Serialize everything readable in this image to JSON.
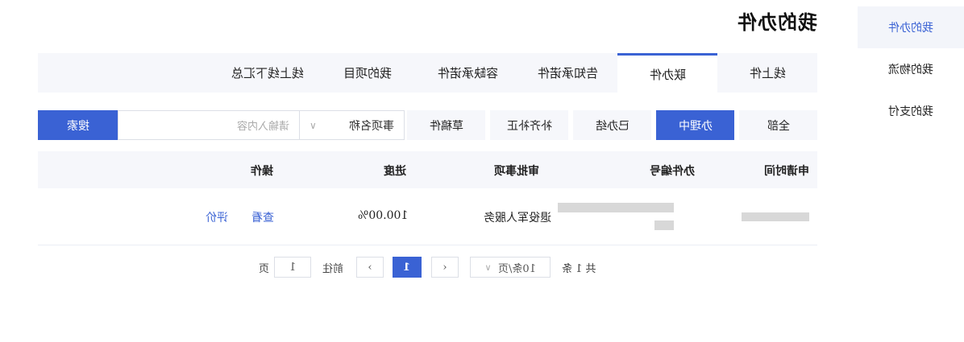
{
  "page_title": "我的办件",
  "sidebar": {
    "items": [
      {
        "label": "我的办件",
        "active": true
      },
      {
        "label": "我的物流"
      },
      {
        "label": "我的支付"
      }
    ]
  },
  "tabs": [
    "线上件",
    "联办件",
    "告知承诺件",
    "容缺承诺件",
    "我的项目",
    "线上线下汇总"
  ],
  "active_tab": 1,
  "filters": [
    "全部",
    "办理中",
    "已办结",
    "补齐补正",
    "草稿件"
  ],
  "active_filter": 1,
  "search": {
    "select_value": "事项名称",
    "placeholder": "请输入内容",
    "button": "搜索"
  },
  "table": {
    "headers": [
      "申请时间",
      "办件编号",
      "审批事项",
      "进度",
      "操作"
    ],
    "row": {
      "item": "退役军人服务",
      "progress": "100.00%",
      "action_view": "查看",
      "action_rate": "评价"
    }
  },
  "pagination": {
    "total": "共 1 条",
    "page_size": "10条/页",
    "current": "1",
    "goto": "前往",
    "goto_value": "1",
    "unit": "页"
  },
  "colors": {
    "accent": "#3a62d4",
    "panel": "#f6f7fb"
  }
}
